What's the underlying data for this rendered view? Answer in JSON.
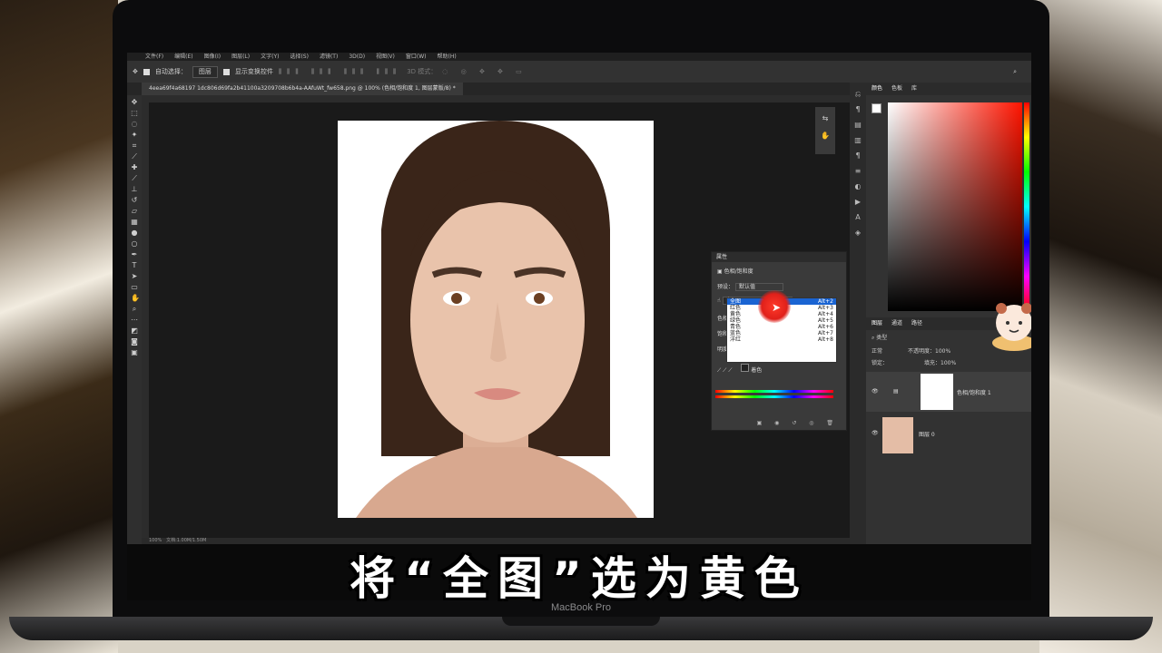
{
  "menu": [
    "文件(F)",
    "编辑(E)",
    "图像(I)",
    "图层(L)",
    "文字(Y)",
    "选择(S)",
    "滤镜(T)",
    "3D(D)",
    "视图(V)",
    "窗口(W)",
    "帮助(H)"
  ],
  "options": {
    "auto_select_label": "自动选择：",
    "auto_select_value": "图层",
    "show_transform": "显示变换控件",
    "mode_3d": "3D 模式："
  },
  "document_tab": "4eea69f4a68197 1dc806d69fa2b41100a3209708b6b4a-AAfuWt_fw658.png @ 100% (色相/饱和度 1, 图层蒙版/8) *",
  "status_zoom": "100%",
  "status_doc": "文档:1.00M/1.50M",
  "properties": {
    "title": "属性",
    "adjustment": "色相/饱和度",
    "preset_label": "预设：",
    "preset_value": "默认值",
    "channel_value": "全图",
    "hue_label": "色相",
    "saturation_label": "饱和度",
    "lightness_label": "明度",
    "colorize_label": "着色"
  },
  "channel_options": [
    {
      "label": "全图",
      "shortcut": "Alt+2"
    },
    {
      "label": "红色",
      "shortcut": "Alt+3"
    },
    {
      "label": "黄色",
      "shortcut": "Alt+4"
    },
    {
      "label": "绿色",
      "shortcut": "Alt+5"
    },
    {
      "label": "青色",
      "shortcut": "Alt+6"
    },
    {
      "label": "蓝色",
      "shortcut": "Alt+7"
    },
    {
      "label": "洋红",
      "shortcut": "Alt+8"
    }
  ],
  "color_panel_tabs": [
    "颜色",
    "色板",
    "库"
  ],
  "layers_panel_tabs": [
    "图层",
    "通道",
    "路径"
  ],
  "layers": {
    "kind_label": "类型",
    "blend_mode": "正常",
    "opacity_label": "不透明度：",
    "opacity_value": "100%",
    "lock_label": "锁定：",
    "fill_label": "填充：",
    "fill_value": "100%",
    "items": [
      {
        "name": "色相/饱和度 1"
      },
      {
        "name": "图层 0"
      }
    ]
  },
  "subtitle": "将“全图”选为黄色",
  "device_label": "MacBook Pro"
}
